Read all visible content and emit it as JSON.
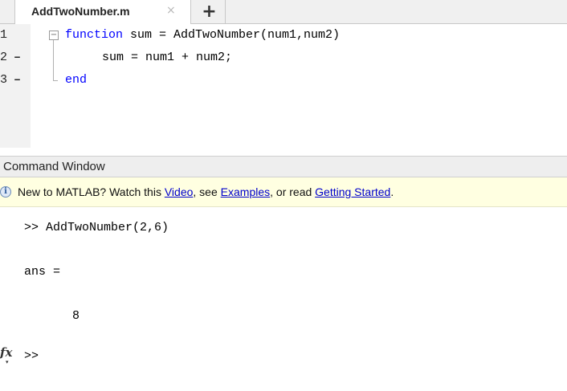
{
  "editor_tabs": {
    "active_file": "AddTwoNumber.m",
    "close_symbol": "×",
    "add_symbol": "+"
  },
  "editor": {
    "line_numbers": [
      "1",
      "2",
      "3"
    ],
    "breakpoint_markers": [
      "–",
      "–"
    ],
    "fold_symbol": "−",
    "line1": {
      "keyword": "function",
      "rest": " sum = AddTwoNumber(num1,num2)"
    },
    "line2": {
      "text": "sum = num1 + num2;"
    },
    "line3": {
      "keyword": "end"
    }
  },
  "command_window": {
    "title": "Command Window",
    "banner": {
      "prefix": "New to MATLAB? Watch this ",
      "video_link": "Video",
      "sep1": ", see ",
      "examples_link": "Examples",
      "sep2": ", or read ",
      "getting_started_link": "Getting Started",
      "suffix": "."
    },
    "lines": {
      "command": ">> AddTwoNumber(2,6)",
      "ans_label": "ans =",
      "ans_value": "8",
      "prompt": ">>"
    },
    "fx_label": "fx",
    "fx_arrow": "▾"
  }
}
